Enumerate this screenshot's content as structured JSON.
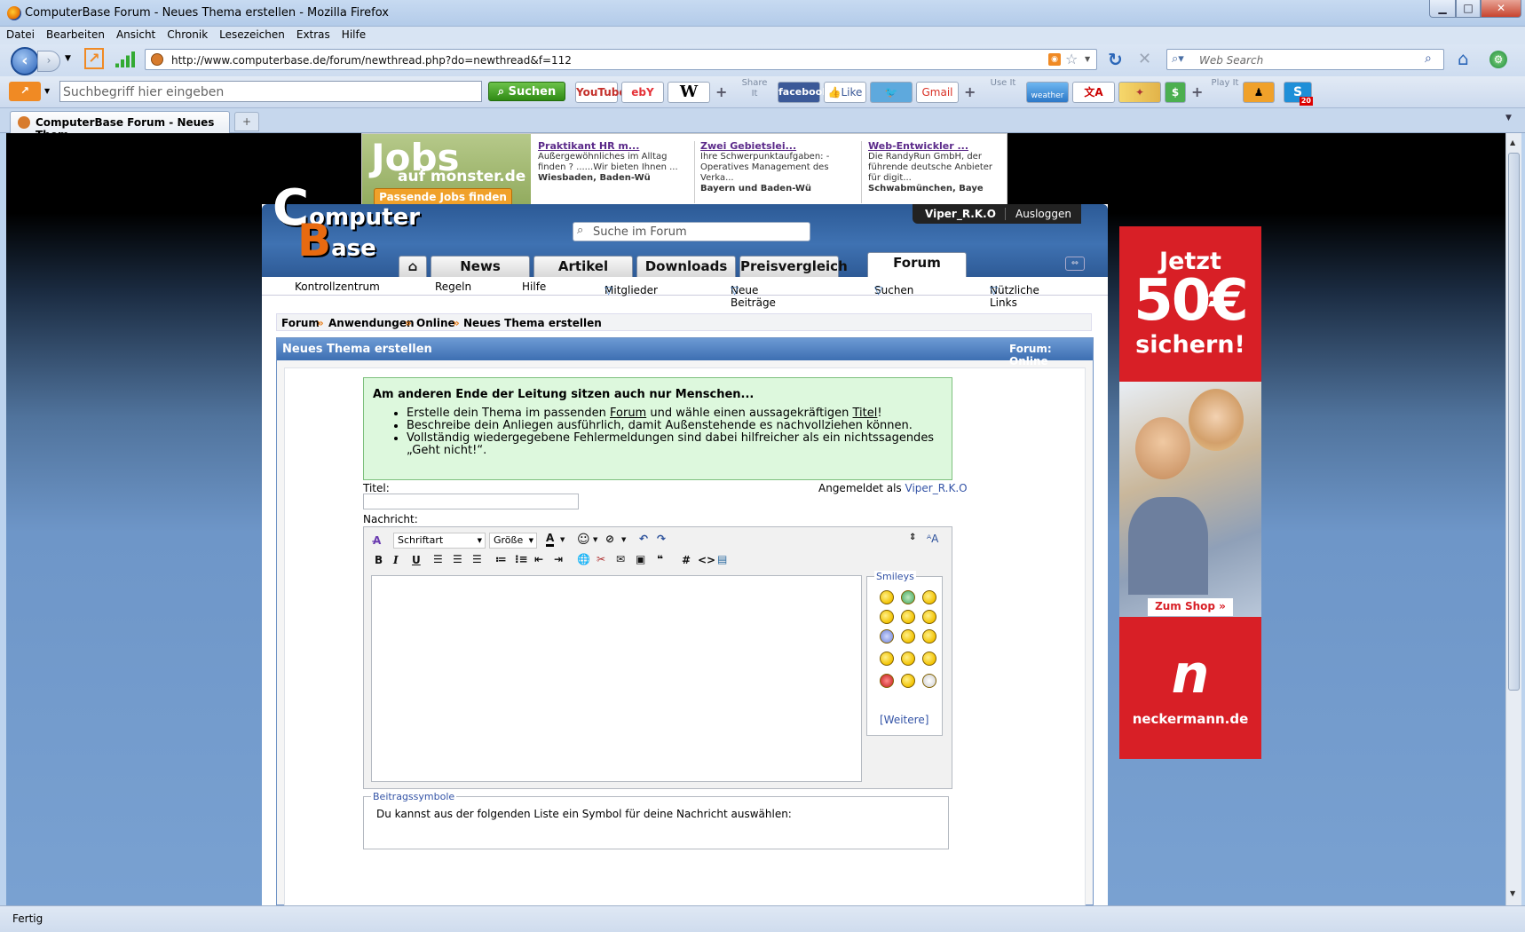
{
  "window": {
    "title": "ComputerBase Forum - Neues Thema erstellen - Mozilla Firefox"
  },
  "menu": [
    "Datei",
    "Bearbeiten",
    "Ansicht",
    "Chronik",
    "Lesezeichen",
    "Extras",
    "Hilfe"
  ],
  "nav": {
    "url": "http://www.computerbase.de/forum/newthread.php?do=newthread&f=112",
    "search_placeholder": "Web Search"
  },
  "toolbar": {
    "search_placeholder": "Suchbegriff hier eingeben",
    "search_button": "Suchen",
    "share_label": "Share It",
    "use_label": "Use It",
    "play_label": "Play It",
    "youtube": "YouTube",
    "ebay": "ebY",
    "wiki": "W",
    "facebook": "facebook",
    "like": "Like",
    "gmail": "Gmail",
    "weather": "weather",
    "skype_badge": "20"
  },
  "tab": {
    "title": "ComputerBase Forum - Neues Them..."
  },
  "status": "Fertig",
  "ad_top": {
    "logo_main": "Jobs",
    "logo_sub": "auf monster.de",
    "button": "Passende Jobs finden",
    "jobs": [
      {
        "title": "Praktikant HR m...",
        "desc": "Außergewöhnliches im Alltag finden ? ......Wir bieten Ihnen ...",
        "loc": "Wiesbaden, Baden-Wü"
      },
      {
        "title": "Zwei Gebietslei...",
        "desc": "Ihre Schwerpunktaufgaben: - Operatives Management des Verka...",
        "loc": "Bayern und Baden-Wü"
      },
      {
        "title": "Web-Entwickler ...",
        "desc": "Die RandyRun GmbH, der führende deutsche Anbieter für digit...",
        "loc": "Schwabmünchen, Baye"
      }
    ]
  },
  "site": {
    "logo_c": "C",
    "logo_omputer": "omputer",
    "logo_b": "B",
    "logo_ase": "ase",
    "user": "Viper_R.K.O",
    "logout": "Ausloggen",
    "search_placeholder": "Suche im Forum",
    "tabs": [
      "News",
      "Artikel",
      "Downloads",
      "Preisvergleich",
      "Forum"
    ],
    "subnav": [
      "Kontrollzentrum",
      "Regeln",
      "Hilfe",
      "Mitglieder",
      "Neue Beiträge",
      "Suchen",
      "Nützliche Links"
    ]
  },
  "breadcrumb": [
    "Forum",
    "Anwendungen",
    "Online",
    "Neues Thema erstellen"
  ],
  "panel": {
    "title": "Neues Thema erstellen",
    "forum_label": "Forum:",
    "forum_value": "Online",
    "hint_title": "Am anderen Ende der Leitung sitzen auch nur Menschen...",
    "hint_items": {
      "i1a": "Erstelle dein Thema im passenden ",
      "i1b": "Forum",
      "i1c": " und wähle einen aussagekräftigen ",
      "i1d": "Titel",
      "i1e": "!",
      "i2": "Beschreibe dein Anliegen ausführlich, damit Außenstehende es nachvollziehen können.",
      "i3": "Vollständig wiedergegebene Fehlermeldungen sind dabei hilfreicher als ein nichtssagendes „Geht nicht!“."
    },
    "titel_label": "Titel:",
    "logged_in": "Angemeldet als",
    "logged_user": "Viper_R.K.O",
    "nachricht_label": "Nachricht:",
    "font_select": "Schriftart",
    "size_select": "Größe",
    "smileys_legend": "Smileys",
    "more": "[Weitere]",
    "symbols_legend": "Beitragssymbole",
    "symbols_text": "Du kannst aus der folgenden Liste ein Symbol für deine Nachricht auswählen:"
  },
  "ad_right": {
    "l1": "Jetzt",
    "l2": "50€",
    "l3": "sichern!",
    "shop": "Zum Shop »",
    "brand": "neckermann.de"
  },
  "colors": {
    "accent": "#3d6fb2",
    "hint_bg": "#ddf8dd",
    "ad_red": "#d81f26",
    "link": "#3353a6"
  }
}
